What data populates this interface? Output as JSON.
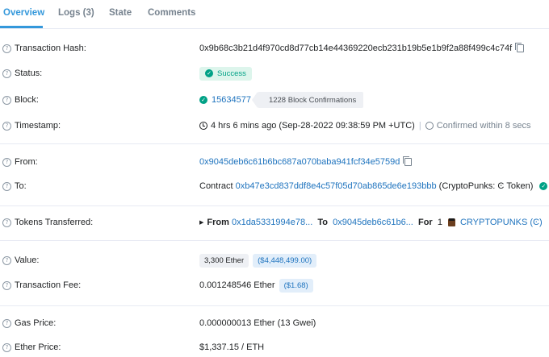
{
  "tabs": [
    {
      "label": "Overview",
      "active": true
    },
    {
      "label": "Logs (3)",
      "active": false
    },
    {
      "label": "State",
      "active": false
    },
    {
      "label": "Comments",
      "active": false
    }
  ],
  "fields": {
    "tx_hash": {
      "label": "Transaction Hash:",
      "value": "0x9b68c3b21d4f970cd8d77cb14e44369220ecb231b19b5e1b9f2a88f499c4c74f"
    },
    "status": {
      "label": "Status:",
      "value": "Success"
    },
    "block": {
      "label": "Block:",
      "value": "15634577",
      "confirmations": "1228 Block Confirmations"
    },
    "timestamp": {
      "label": "Timestamp:",
      "value": "4 hrs 6 mins ago (Sep-28-2022 09:38:59 PM +UTC)",
      "confirmed": "Confirmed within 8 secs"
    },
    "from": {
      "label": "From:",
      "value": "0x9045deb6c61b6bc687a070baba941fcf34e5759d"
    },
    "to": {
      "label": "To:",
      "prefix": "Contract",
      "address": "0xb47e3cd837ddf8e4c57f05d70ab865de6e193bbb",
      "name": "(CryptoPunks: Ͼ Token)"
    },
    "tokens": {
      "label": "Tokens Transferred:",
      "from_label": "From",
      "from_value": "0x1da5331994e78...",
      "to_label": "To",
      "to_value": "0x9045deb6c61b6...",
      "for_label": "For",
      "amount": "1",
      "token": "CRYPTOPUNKS (Ͼ)"
    },
    "value": {
      "label": "Value:",
      "amount": "3,300 Ether",
      "usd": "($4,448,499.00)"
    },
    "fee": {
      "label": "Transaction Fee:",
      "amount": "0.001248546 Ether",
      "usd": "($1.68)"
    },
    "gas_price": {
      "label": "Gas Price:",
      "value": "0.000000013 Ether (13 Gwei)"
    },
    "ether_price": {
      "label": "Ether Price:",
      "value": "$1,337.15 / ETH"
    }
  },
  "colors": {
    "accent": "#3498db",
    "link": "#1e73be",
    "success": "#00a186"
  },
  "icons": [
    "question-icon",
    "copy-icon",
    "check-circle-icon",
    "clock-icon",
    "timer-icon",
    "cryptopunk-icon"
  ]
}
